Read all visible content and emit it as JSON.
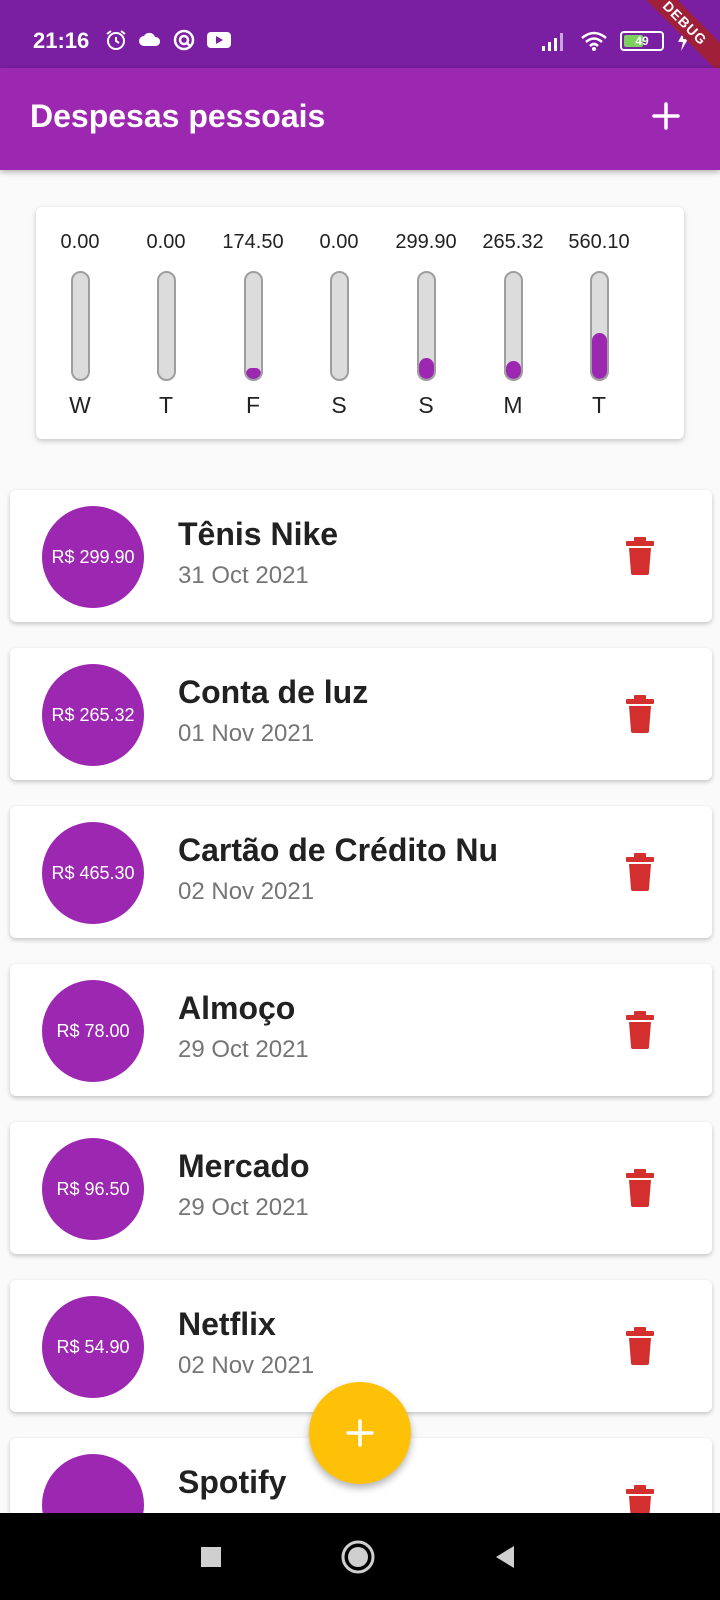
{
  "status_bar": {
    "time": "21:16",
    "battery": "49",
    "debug_label": "DEBUG",
    "left_icons": [
      "alarm-icon",
      "cloud-icon",
      "sync-icon",
      "youtube-icon"
    ],
    "right_icons": [
      "signal-icon",
      "wifi-icon",
      "battery-icon",
      "charging-icon"
    ]
  },
  "app_bar": {
    "title": "Despesas pessoais",
    "add_icon": "plus-icon"
  },
  "chart": {
    "days": [
      {
        "day": "W",
        "value": "0.00",
        "fraction": 0.0
      },
      {
        "day": "T",
        "value": "0.00",
        "fraction": 0.0
      },
      {
        "day": "F",
        "value": "174.50",
        "fraction": 0.1
      },
      {
        "day": "S",
        "value": "0.00",
        "fraction": 0.0
      },
      {
        "day": "S",
        "value": "299.90",
        "fraction": 0.2
      },
      {
        "day": "M",
        "value": "265.32",
        "fraction": 0.17
      },
      {
        "day": "T",
        "value": "560.10",
        "fraction": 0.43
      }
    ]
  },
  "transactions": [
    {
      "amount": "R$ 299.90",
      "title": "Tênis Nike",
      "date": "31 Oct 2021"
    },
    {
      "amount": "R$ 265.32",
      "title": "Conta de luz",
      "date": "01 Nov 2021"
    },
    {
      "amount": "R$ 465.30",
      "title": "Cartão de Crédito Nu",
      "date": "02 Nov 2021"
    },
    {
      "amount": "R$ 78.00",
      "title": "Almoço",
      "date": "29 Oct 2021"
    },
    {
      "amount": "R$ 96.50",
      "title": "Mercado",
      "date": "29 Oct 2021"
    },
    {
      "amount": "R$ 54.90",
      "title": "Netflix",
      "date": "02 Nov 2021"
    },
    {
      "amount": "",
      "title": "Spotify",
      "date": ""
    }
  ],
  "fab": {
    "icon": "plus-icon"
  },
  "nav_bar": {
    "icons": [
      "recents-square-icon",
      "home-circle-icon",
      "back-triangle-icon"
    ]
  },
  "colors": {
    "primary": "#9c27b0",
    "status_bar": "#7b1fa2",
    "accent": "#ffc107",
    "delete": "#d32f2f",
    "bar_track": "#dcdcdc"
  }
}
